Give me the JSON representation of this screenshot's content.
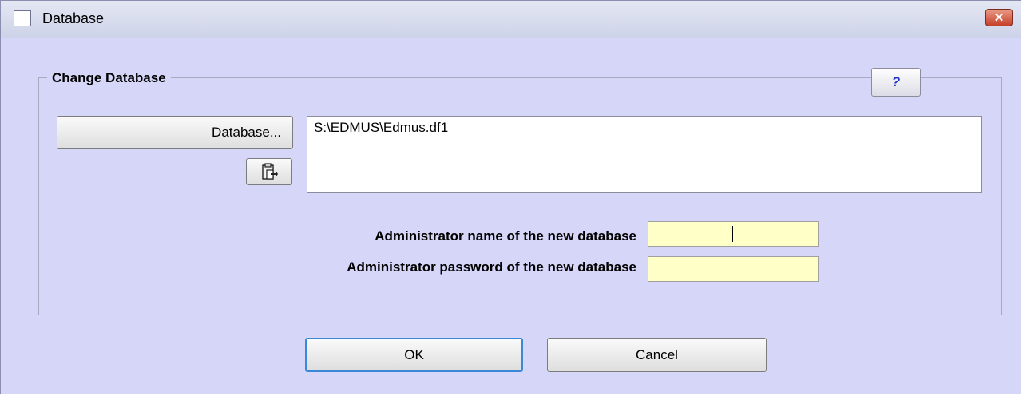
{
  "window": {
    "title": "Database",
    "close_label": "✕"
  },
  "group": {
    "title": "Change Database",
    "help_label": "?"
  },
  "database": {
    "button_label": "Database...",
    "path_value": "S:\\EDMUS\\Edmus.df1",
    "paste_icon": "clipboard-paste-icon"
  },
  "admin": {
    "name_label": "Administrator name of the new database",
    "name_value": "",
    "password_label": "Administrator password of the new database",
    "password_value": ""
  },
  "actions": {
    "ok_label": "OK",
    "cancel_label": "Cancel"
  },
  "colors": {
    "window_bg": "#d6d6f8",
    "field_bg": "#ffffc8",
    "close_red": "#c5402a"
  }
}
